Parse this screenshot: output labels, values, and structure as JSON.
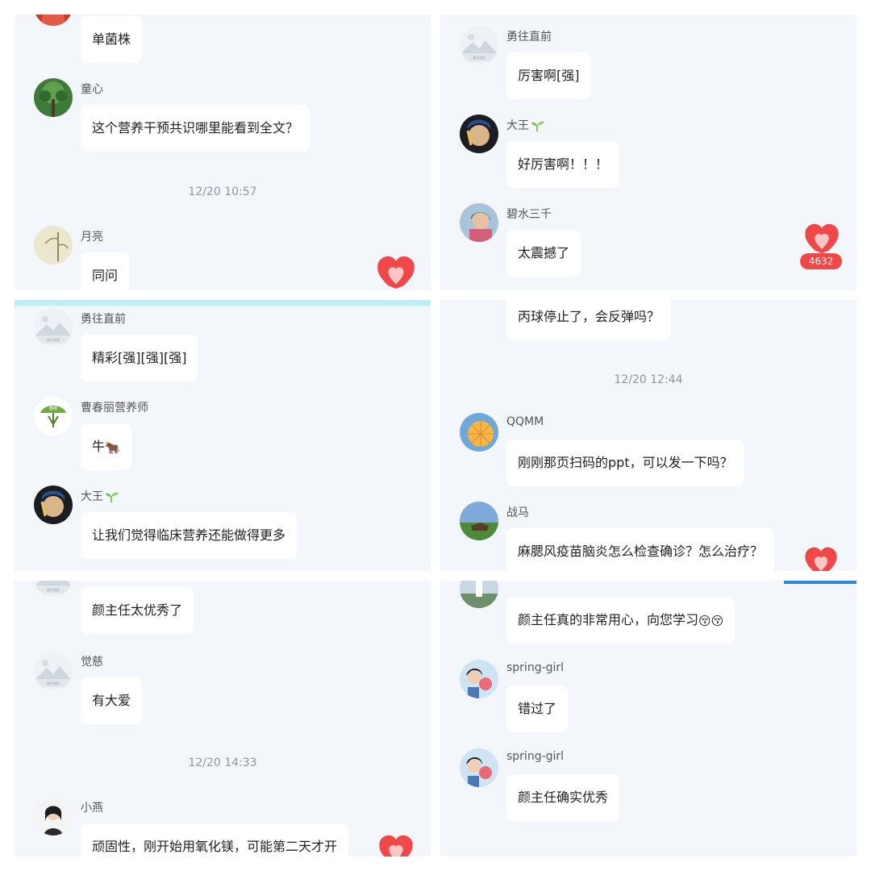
{
  "panel1": {
    "row0_bubble": "单菌株",
    "row1_name": "童心",
    "row1_bubble": "这个营养干预共识哪里能看到全文？",
    "time": "12/20 10:57",
    "row2_name": "月亮",
    "row2_bubble": "同问"
  },
  "panel2": {
    "row1_name": "勇往直前",
    "row1_bubble": "厉害啊[强]",
    "row2_name": "大王",
    "row2_bubble": "好厉害啊！！！",
    "row3_name": "碧水三千",
    "row3_bubble": "太震撼了",
    "like_count": "4632"
  },
  "panel3": {
    "row1_name": "勇往直前",
    "row1_bubble": "精彩[强][强][强]",
    "row2_name": "曹春丽营养师",
    "row2_bubble": "牛",
    "row2_emoji": "🐂",
    "row3_name": "大王",
    "row3_bubble": "让我们觉得临床营养还能做得更多"
  },
  "panel4": {
    "row0_bubble": "丙球停止了，会反弹吗？",
    "time": "12/20 12:44",
    "row1_name": "QQMM",
    "row1_bubble": "刚刚那页扫码的ppt，可以发一下吗？",
    "row2_name": "战马",
    "row2_bubble": "麻腮风疫苗脑炎怎么检查确诊？怎么治疗？"
  },
  "panel5": {
    "row0_bubble": "颜主任太优秀了",
    "row1_name": "觉慈",
    "row1_bubble": "有大爱",
    "time": "12/20 14:33",
    "row2_name": "小燕",
    "row2_bubble": "顽固性，刚开始用氧化镁，可能第二天才开"
  },
  "panel6": {
    "row0_bubble": "颜主任真的非常用心，向您学习",
    "row0_emoji": "😚😚",
    "row1_name": "spring-girl",
    "row1_bubble": "错过了",
    "row2_name": "spring-girl",
    "row2_bubble": "颜主任确实优秀"
  },
  "colors": {
    "panel_bg": "#f3f6fa",
    "bubble_bg": "#ffffff",
    "accent_red": "#f04848",
    "timestamp": "#8e96a0"
  }
}
